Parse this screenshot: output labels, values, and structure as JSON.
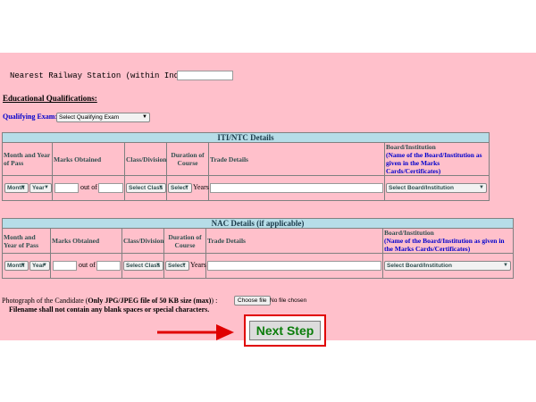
{
  "railway": {
    "label": "Nearest Railway Station (within India)",
    "value": ""
  },
  "education": {
    "heading": "Educational Qualifications:",
    "qualifying_label": "Qualifying Exam:",
    "qualifying_select": "Select Qualifying Exam"
  },
  "iti": {
    "title": "ITI/NTC Details",
    "headers": {
      "month_year": "Month and Year of Pass",
      "marks": "Marks Obtained",
      "class": "Class/Division",
      "duration": "Duration of Course",
      "trade": "Trade Details",
      "board_title": "Board/Institution",
      "board_sub": "(Name of the Board/Institution as given in the Marks Cards/Certificates)"
    },
    "row": {
      "month": "Month",
      "year": "Year",
      "out_of": "out of",
      "class_select": "Select Class",
      "duration_select": "Select",
      "years": "Years",
      "board_select": "Select Board/Institution"
    }
  },
  "nac": {
    "title": "NAC Details (if applicable)",
    "headers": {
      "month_year": "Month and Year of Pass",
      "marks": "Marks Obtained",
      "class": "Class/Division",
      "duration": "Duration of Course",
      "trade": "Trade Details",
      "board_title": "Board/Institution",
      "board_sub": "(Name of the Board/Institution as given in the Marks Cards/Certificates)"
    },
    "row": {
      "month": "Month",
      "year": "Year",
      "out_of": "out of",
      "class_select": "Select Class",
      "duration_select": "Select",
      "years": "Years",
      "board_select": "Select Board/Institution"
    }
  },
  "photo": {
    "label_prefix": "Photograph of the Candidate (",
    "label_bold": "Only JPG/JPEG file of 50 KB size (max)",
    "label_suffix": ") :",
    "choose_button": "Choose file",
    "no_file": "No file chosen",
    "note": "Filename shall not contain any blank spaces or special characters."
  },
  "next_button": "Next Step",
  "colors": {
    "panel": "#ffc0cb",
    "table_header": "#b6dde8",
    "highlight": "#e00000",
    "next_text": "#0b7d0b"
  }
}
